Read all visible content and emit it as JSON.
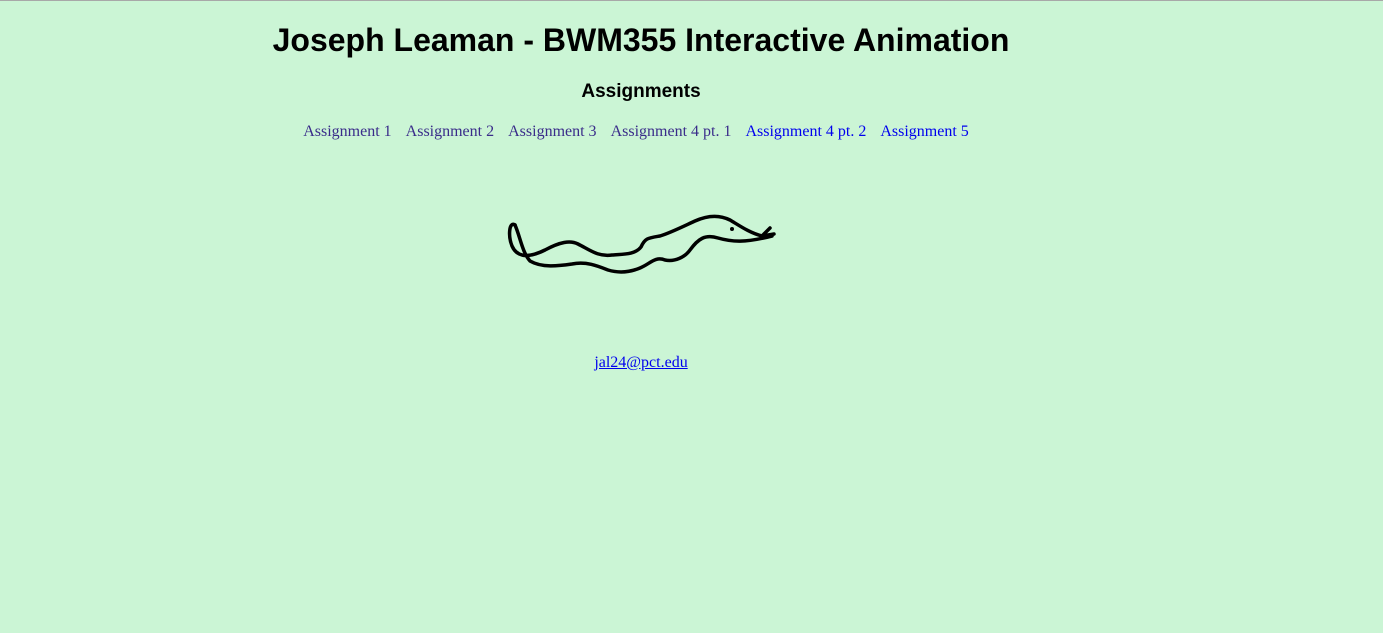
{
  "page": {
    "title": "Joseph Leaman - BWM355 Interactive Animation",
    "section_heading": "Assignments"
  },
  "nav": {
    "items": [
      {
        "label": "Assignment 1",
        "state": "visited"
      },
      {
        "label": "Assignment 2",
        "state": "visited"
      },
      {
        "label": "Assignment 3",
        "state": "visited"
      },
      {
        "label": "Assignment 4 pt. 1",
        "state": "visited"
      },
      {
        "label": "Assignment 4 pt. 2",
        "state": "unvisited"
      },
      {
        "label": "Assignment 5",
        "state": "unvisited"
      }
    ]
  },
  "illustration": {
    "icon": "snake-drawing"
  },
  "contact": {
    "email": "jal24@pct.edu"
  },
  "colors": {
    "background": "#cbf5d5",
    "link": "#0000ee",
    "visited_link": "#3a2c8a",
    "text": "#000000"
  }
}
